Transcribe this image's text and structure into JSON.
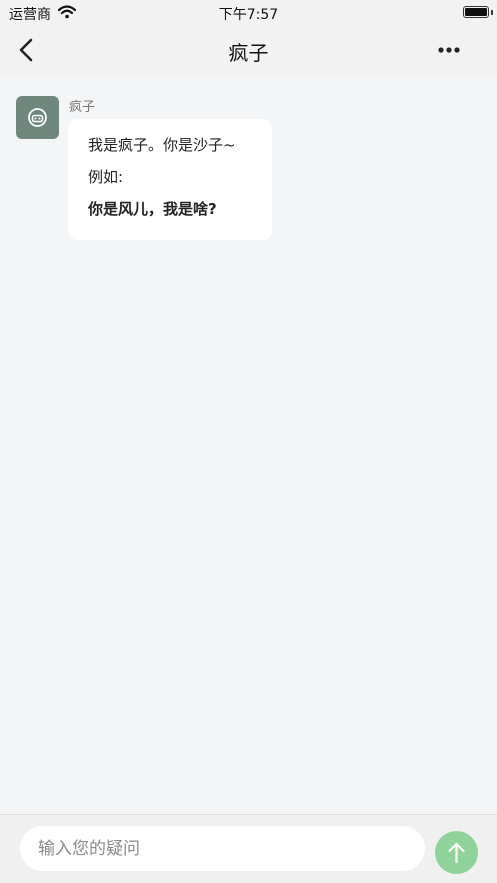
{
  "status_bar": {
    "carrier": "运营商",
    "time": "下午7:57",
    "wifi_icon": "wifi-icon",
    "battery_icon": "battery-full-icon",
    "battery_level": 1.0
  },
  "nav": {
    "title": "疯子",
    "back_icon": "chevron-left-icon",
    "more_icon": "more-horizontal-icon"
  },
  "messages": [
    {
      "sender": "疯子",
      "avatar_icon": "robot-face-icon",
      "avatar_color": "#6f877d",
      "lines": [
        "我是疯子。你是沙子~",
        "例如:"
      ],
      "bold_line": "你是风儿，我是啥?"
    }
  ],
  "composer": {
    "placeholder": "输入您的疑问",
    "value": "",
    "send_icon": "arrow-up-icon",
    "send_color": "#8fd39b"
  }
}
